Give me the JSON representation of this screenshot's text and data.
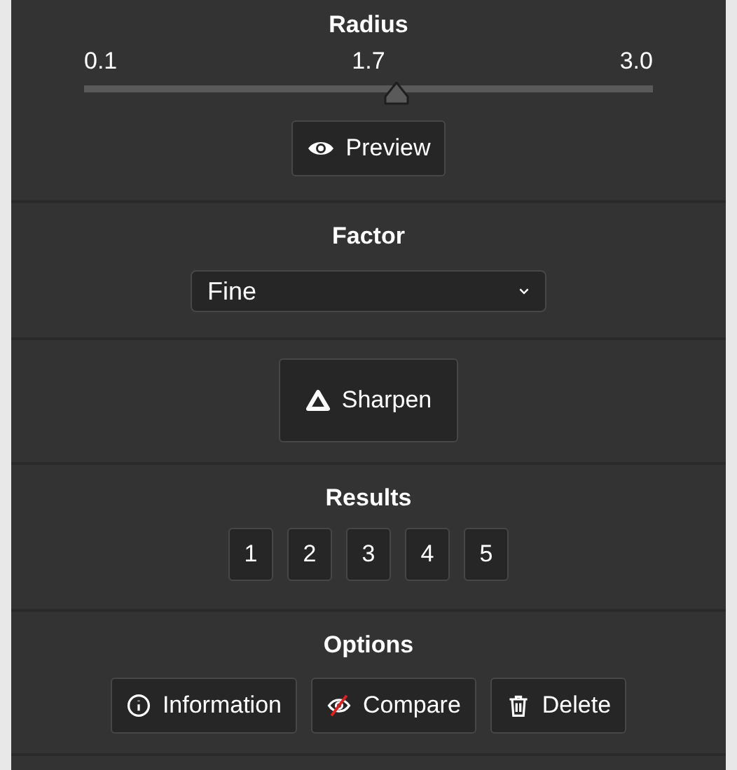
{
  "radius": {
    "title": "Radius",
    "min_label": "0.1",
    "value_label": "1.7",
    "max_label": "3.0",
    "level": 0.55,
    "button": "Preview"
  },
  "factor": {
    "title": "Factor",
    "value": "Fine"
  },
  "action": {
    "button": "Sharpen"
  },
  "results": {
    "title": "Results",
    "items": [
      "1",
      "2",
      "3",
      "4",
      "5"
    ]
  },
  "options": {
    "title": "Options",
    "buttons": [
      {
        "kind": "info",
        "label": "Information"
      },
      {
        "kind": "compare",
        "label": "Compare"
      },
      {
        "kind": "delete",
        "label": "Delete"
      }
    ]
  }
}
